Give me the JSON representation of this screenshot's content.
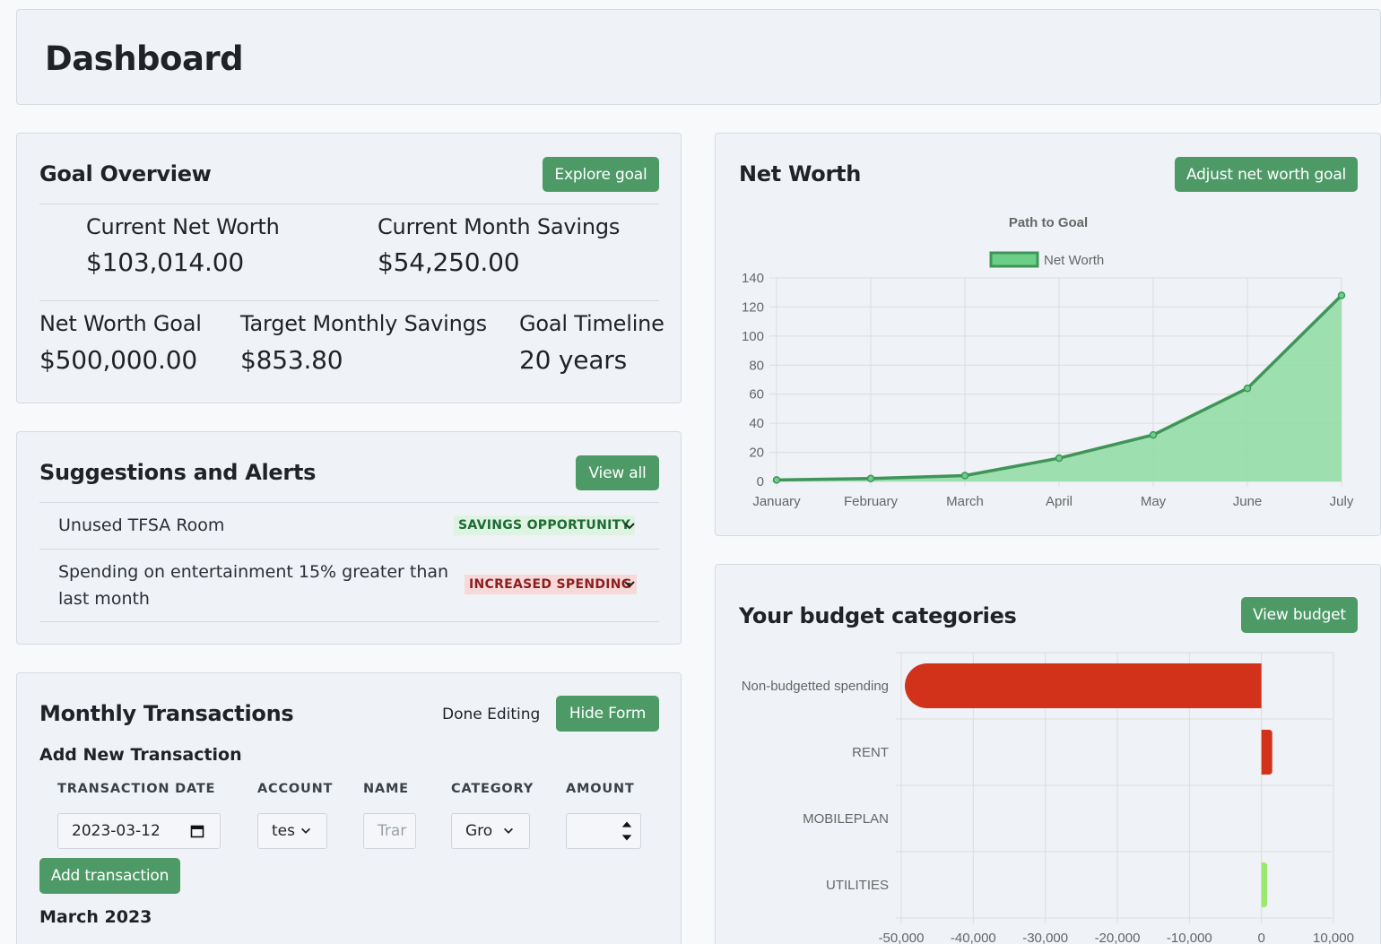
{
  "header": {
    "title": "Dashboard"
  },
  "goal_overview": {
    "title": "Goal Overview",
    "explore_label": "Explore goal",
    "current_net_worth_label": "Current Net Worth",
    "current_net_worth_value": "$103,014.00",
    "current_month_savings_label": "Current Month Savings",
    "current_month_savings_value": "$54,250.00",
    "net_worth_goal_label": "Net Worth Goal",
    "net_worth_goal_value": "$500,000.00",
    "target_monthly_savings_label": "Target Monthly Savings",
    "target_monthly_savings_value": "$853.80",
    "goal_timeline_label": "Goal Timeline",
    "goal_timeline_value": "20 years"
  },
  "suggestions": {
    "title": "Suggestions and Alerts",
    "view_all_label": "View all",
    "items": [
      {
        "text": "Unused TFSA Room",
        "badge": "SAVINGS OPPORTUNITY",
        "badge_bg": "#dff3e3",
        "badge_color": "#1c6b34"
      },
      {
        "text": "Spending on entertainment 15% greater than last month",
        "badge": "INCREASED SPENDING",
        "badge_bg": "#f7d9d9",
        "badge_color": "#8a1f1f"
      }
    ]
  },
  "transactions": {
    "title": "Monthly Transactions",
    "done_editing_label": "Done Editing",
    "hide_form_label": "Hide Form",
    "form_title": "Add New Transaction",
    "col_date": "TRANSACTION DATE",
    "col_account": "ACCOUNT",
    "col_name": "NAME",
    "col_category": "CATEGORY",
    "col_amount": "AMOUNT",
    "date_value": "2023-03-12",
    "account_value": "tes",
    "name_placeholder": "Trar",
    "category_value": "Gro",
    "amount_value": "",
    "add_label": "Add transaction",
    "month_heading": "March 2023"
  },
  "net_worth": {
    "title": "Net Worth",
    "adjust_label": "Adjust net worth goal",
    "chart_title": "Path to Goal",
    "legend_label": "Net Worth"
  },
  "budget": {
    "title": "Your budget categories",
    "view_label": "View budget"
  },
  "colors": {
    "accent": "#4e9a66",
    "line": "#3f9558",
    "fill": "#8fdca3",
    "bar_red": "#d2321a",
    "bar_green": "#9be86f"
  },
  "chart_data": [
    {
      "type": "area",
      "title": "Path to Goal",
      "categories": [
        "January",
        "February",
        "March",
        "April",
        "May",
        "June",
        "July"
      ],
      "series": [
        {
          "name": "Net Worth",
          "values": [
            1,
            2,
            4,
            16,
            32,
            64,
            128
          ]
        }
      ],
      "ylim": [
        0,
        140
      ],
      "yticks": [
        0,
        20,
        40,
        60,
        80,
        100,
        120,
        140
      ],
      "legend": "top",
      "grid": true
    },
    {
      "type": "bar",
      "orientation": "horizontal",
      "categories": [
        "Non-budgetted spending",
        "RENT",
        "MOBILEPLAN",
        "UTILITIES"
      ],
      "values": [
        -49500,
        1500,
        0,
        800
      ],
      "bar_colors": [
        "#d2321a",
        "#d2321a",
        "#d2321a",
        "#9be86f"
      ],
      "xlim": [
        -50000,
        10000
      ],
      "xticks": [
        "-50,000",
        "-40,000",
        "-30,000",
        "-20,000",
        "-10,000",
        "0",
        "10,000"
      ],
      "xtick_values": [
        -50000,
        -40000,
        -30000,
        -20000,
        -10000,
        0,
        10000
      ],
      "grid": true
    }
  ]
}
